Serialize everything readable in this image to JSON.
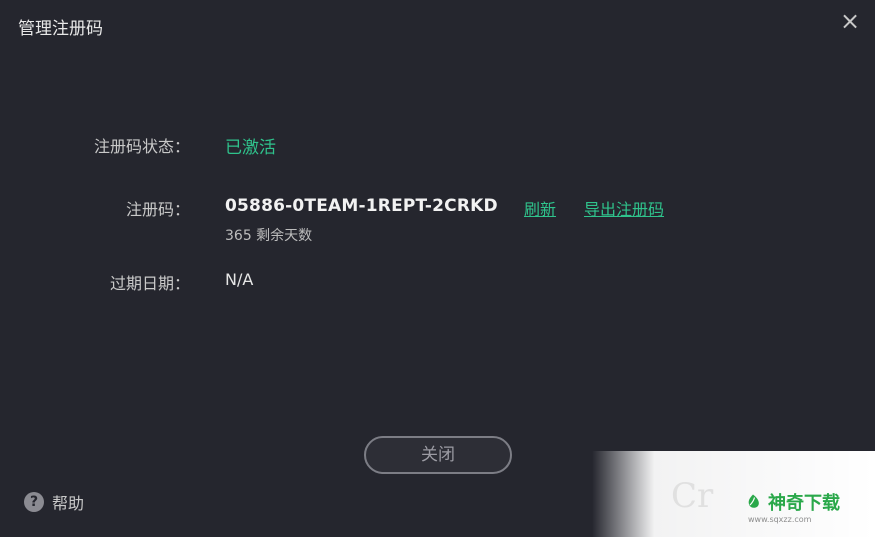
{
  "window": {
    "title": "管理注册码",
    "close_icon": "close-icon"
  },
  "license": {
    "status_label": "注册码状态：",
    "status_value": "已激活",
    "code_label": "注册码：",
    "code_value": "05886-0TEAM-1REPT-2CRKD",
    "refresh_label": "刷新",
    "export_label": "导出注册码",
    "days_left": "365 剩余天数",
    "expiry_label": "过期日期：",
    "expiry_value": "N/A"
  },
  "actions": {
    "close_label": "关闭",
    "help_label": "帮助",
    "help_icon": "question-icon"
  },
  "watermark": {
    "mark": "Cr",
    "brand": "神奇下载",
    "url": "www.sqxzz.com",
    "brand_icon": "leaf-icon"
  },
  "colors": {
    "background": "#25262e",
    "accent": "#2fc38c",
    "text": "#d9d9d9"
  }
}
